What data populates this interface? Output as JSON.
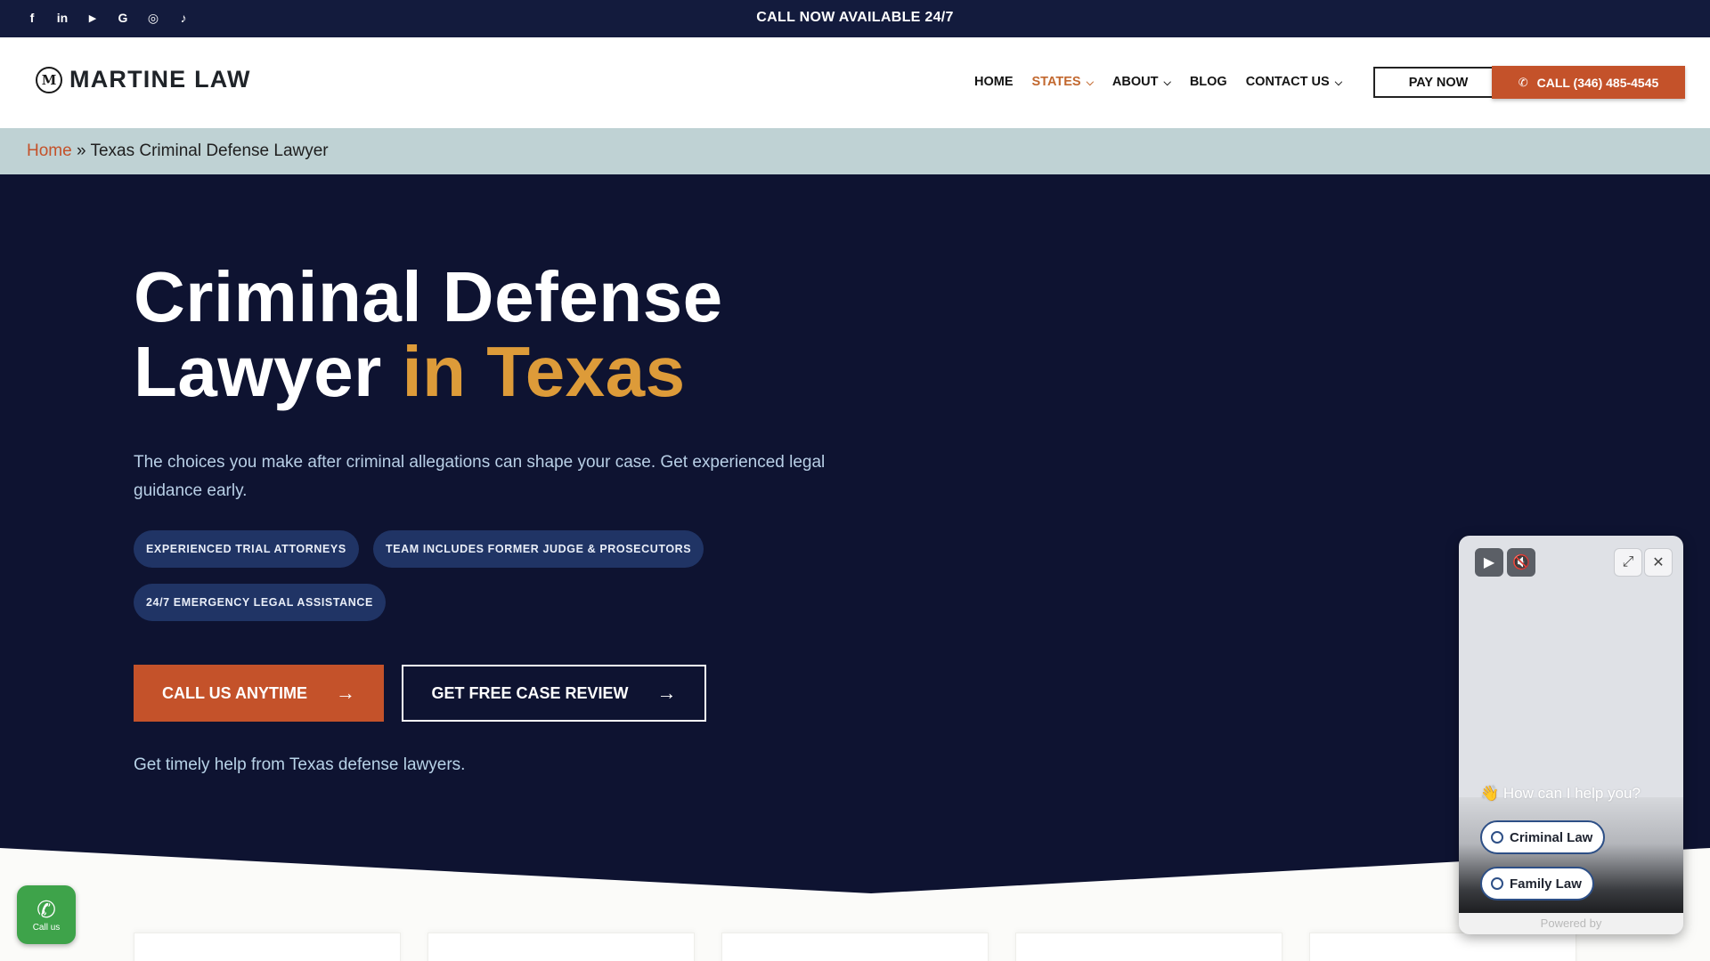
{
  "topbar": {
    "social": [
      {
        "name": "facebook-icon",
        "glyph": "f"
      },
      {
        "name": "linkedin-icon",
        "glyph": "in"
      },
      {
        "name": "youtube-icon",
        "glyph": "▶"
      },
      {
        "name": "google-icon",
        "glyph": "G"
      },
      {
        "name": "instagram-icon",
        "glyph": "◎"
      },
      {
        "name": "tiktok-icon",
        "glyph": "♪"
      }
    ],
    "text": "CALL NOW AVAILABLE 24/7"
  },
  "header": {
    "logo_mark": "M",
    "logo_text": "MARTINE LAW",
    "nav": [
      {
        "label": "HOME",
        "has_dropdown": false,
        "active": false
      },
      {
        "label": "STATES",
        "has_dropdown": true,
        "active": true
      },
      {
        "label": "ABOUT",
        "has_dropdown": true,
        "active": false
      },
      {
        "label": "BLOG",
        "has_dropdown": false,
        "active": false
      },
      {
        "label": "CONTACT US",
        "has_dropdown": true,
        "active": false
      }
    ],
    "pay_label": "PAY NOW",
    "call_label": "CALL (346) 485-4545"
  },
  "breadcrumb": {
    "home": "Home",
    "separator": " » ",
    "current": "Texas Criminal Defense Lawyer"
  },
  "hero": {
    "title_line1": "Criminal Defense",
    "title_line2_a": "Lawyer ",
    "title_line2_b": "in Texas",
    "description": "The choices you make after criminal allegations can shape your case. Get experienced legal guidance early.",
    "pills": [
      "EXPERIENCED TRIAL ATTORNEYS",
      "TEAM INCLUDES FORMER JUDGE & PROSECUTORS",
      "24/7 EMERGENCY LEGAL ASSISTANCE"
    ],
    "cta_primary": "CALL US ANYTIME",
    "cta_secondary": "GET FREE CASE REVIEW",
    "subtext": "Get timely help from Texas defense lawyers."
  },
  "chat": {
    "prompt": "👋 How can I help you?",
    "options": [
      "Criminal Law",
      "Family Law"
    ],
    "powered": "Powered by"
  },
  "callus": {
    "label": "Call us"
  },
  "colors": {
    "navy": "#131b3d",
    "hero_bg": "#0e1331",
    "accent_orange": "#c4522a",
    "accent_gold": "#dd9b39",
    "breadcrumb_bg": "#bfd2d4",
    "pill_bg": "#203465",
    "call_green": "#3ea34a"
  }
}
